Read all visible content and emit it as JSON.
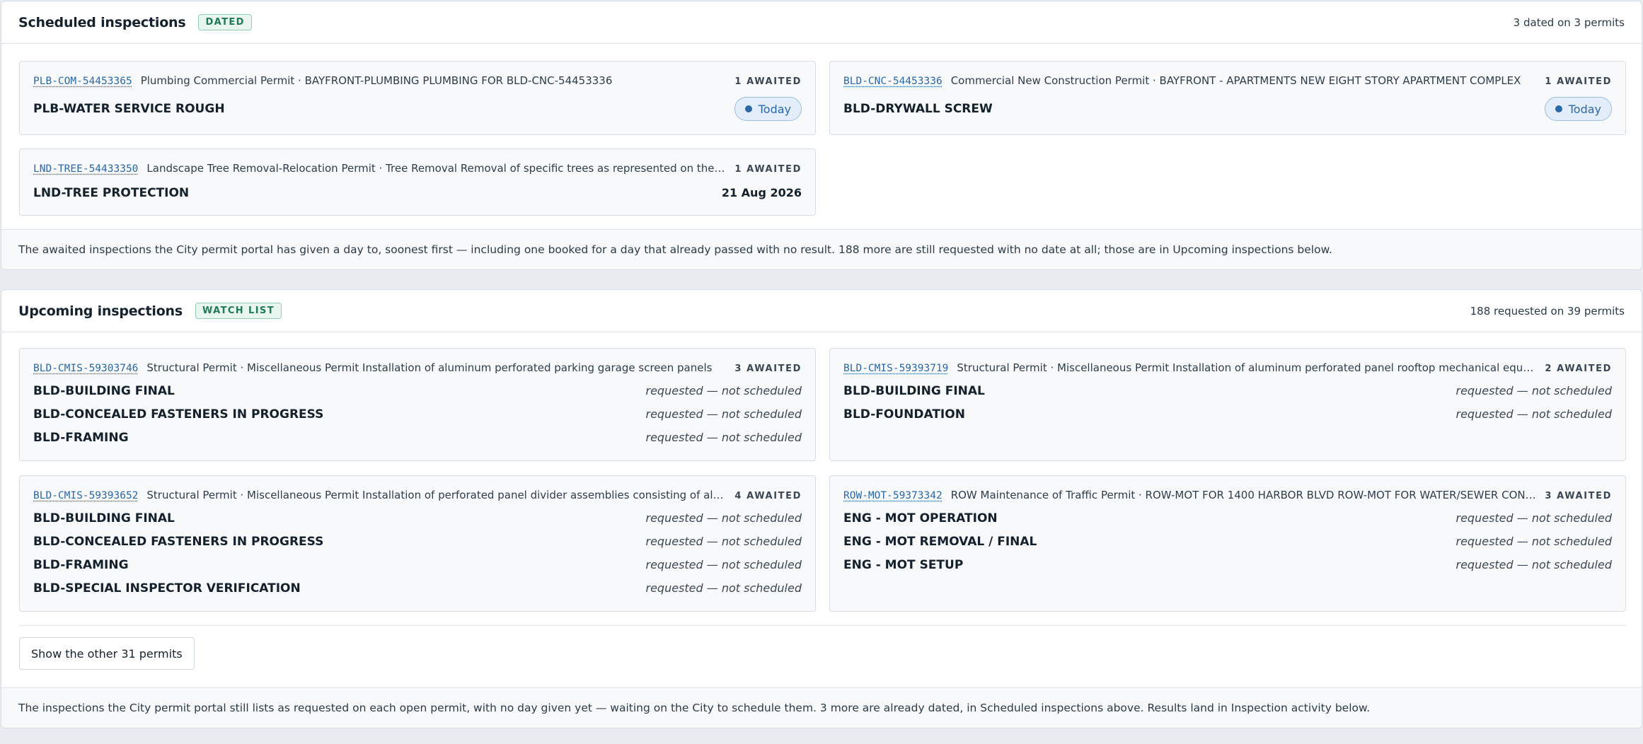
{
  "scheduled": {
    "title": "Scheduled inspections",
    "badge": "DATED",
    "summary": "3 dated on 3 permits",
    "footer": "The awaited inspections the City permit portal has given a day to, soonest first — including one booked for a day that already passed with no result. 188 more are still requested with no date at all; those are in Upcoming inspections below.",
    "cards": [
      {
        "permit_id": "PLB-COM-54453365",
        "description": "Plumbing Commercial Permit · BAYFRONT-PLUMBING PLUMBING FOR BLD-CNC-54453336",
        "awaited": "1 AWAITED",
        "inspections": [
          {
            "name": "PLB-WATER SERVICE ROUGH",
            "when": "Today"
          }
        ]
      },
      {
        "permit_id": "BLD-CNC-54453336",
        "description": "Commercial New Construction Permit · BAYFRONT - APARTMENTS NEW EIGHT STORY APARTMENT COMPLEX",
        "awaited": "1 AWAITED",
        "inspections": [
          {
            "name": "BLD-DRYWALL SCREW",
            "when": "Today"
          }
        ]
      },
      {
        "permit_id": "LND-TREE-54433350",
        "description": "Landscape Tree Removal-Relocation Permit · Tree Removal Removal of specific trees as represented on the plans",
        "awaited": "1 AWAITED",
        "inspections": [
          {
            "name": "LND-TREE PROTECTION",
            "when": "21 Aug 2026"
          }
        ]
      }
    ]
  },
  "upcoming": {
    "title": "Upcoming inspections",
    "badge": "WATCH LIST",
    "summary": "188 requested on 39 permits",
    "status_text": "requested — not scheduled",
    "show_more_label": "Show the other 31 permits",
    "footer": "The inspections the City permit portal still lists as requested on each open permit, with no day given yet — waiting on the City to schedule them. 3 more are already dated, in Scheduled inspections above. Results land in Inspection activity below.",
    "cards": [
      {
        "permit_id": "BLD-CMIS-59303746",
        "description": "Structural Permit · Miscellaneous Permit Installation of aluminum perforated parking garage screen panels",
        "awaited": "3 AWAITED",
        "inspections": [
          "BLD-BUILDING FINAL",
          "BLD-CONCEALED FASTENERS IN PROGRESS",
          "BLD-FRAMING"
        ]
      },
      {
        "permit_id": "BLD-CMIS-59393719",
        "description": "Structural Permit · Miscellaneous Permit Installation of aluminum perforated panel rooftop mechanical equipment screen",
        "awaited": "2 AWAITED",
        "inspections": [
          "BLD-BUILDING FINAL",
          "BLD-FOUNDATION"
        ]
      },
      {
        "permit_id": "BLD-CMIS-59393652",
        "description": "Structural Permit · Miscellaneous Permit Installation of perforated panel divider assemblies consisting of aluminum frames",
        "awaited": "4 AWAITED",
        "inspections": [
          "BLD-BUILDING FINAL",
          "BLD-CONCEALED FASTENERS IN PROGRESS",
          "BLD-FRAMING",
          "BLD-SPECIAL INSPECTOR VERIFICATION"
        ]
      },
      {
        "permit_id": "ROW-MOT-59373342",
        "description": "ROW Maintenance of Traffic Permit · ROW-MOT FOR 1400 HARBOR BLVD ROW-MOT FOR WATER/SEWER CONNECTION",
        "awaited": "3 AWAITED",
        "inspections": [
          "ENG - MOT OPERATION",
          "ENG - MOT REMOVAL / FINAL",
          "ENG - MOT SETUP"
        ]
      }
    ]
  }
}
